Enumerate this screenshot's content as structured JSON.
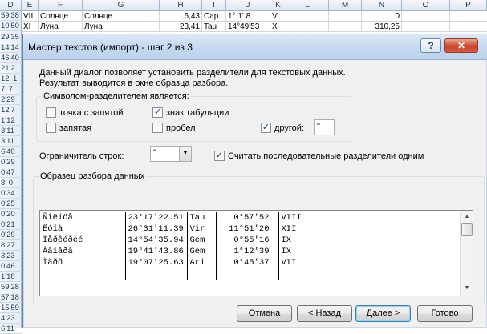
{
  "spreadsheet": {
    "columns": [
      "D",
      "E",
      "F",
      "G",
      "H",
      "I",
      "J",
      "K",
      "L",
      "M",
      "N",
      "O",
      "P"
    ],
    "rows": [
      {
        "num": "59'38",
        "d": "",
        "e": "VII",
        "f": "Солнце",
        "g": "Солнце",
        "h": "6,43",
        "i": "Cap",
        "j": "1° 1' 8",
        "k": "V",
        "n": "0"
      },
      {
        "num": "10'50",
        "d": "",
        "e": "XI",
        "f": "Луна",
        "g": "Луна",
        "h": "23,41",
        "i": "Tau",
        "j": "14°49'53",
        "k": "X",
        "n": "310,25"
      }
    ],
    "row_headers": [
      "29'35",
      "14'14",
      "46'40",
      "21'2",
      "12' 1",
      "7' 7",
      "2'29",
      "12'7",
      "1'12",
      "3'11",
      "3'11",
      "6'40",
      "0'29",
      "0'47",
      "8' 0",
      "0'34",
      "0'25",
      "0'20",
      "0'21",
      "0'29",
      "8'27",
      "3'23",
      "0'46",
      "1'18",
      "59'28",
      "57'18",
      "15'59",
      "4'23",
      "6'11"
    ]
  },
  "dialog": {
    "title": "Мастер текстов (импорт) - шаг 2 из 3",
    "help_button": "?",
    "close_button": "✕",
    "description_line1": "Данный диалог позволяет установить разделители для текстовых данных.",
    "description_line2": "Результат выводится в окне образца разбора.",
    "delimiter_group_label": "Символом-разделителем является:",
    "delimiters": {
      "semicolon": {
        "label": "точка с запятой",
        "checked": false
      },
      "tab": {
        "label": "знак табуляции",
        "checked": true
      },
      "comma": {
        "label": "запятая",
        "checked": false
      },
      "space": {
        "label": "пробел",
        "checked": false
      },
      "other": {
        "label": "другой:",
        "checked": true,
        "value": "\""
      }
    },
    "text_qualifier_label": "Ограничитель строк:",
    "text_qualifier_value": "\"",
    "treat_consecutive_label": "Считать последовательные разделители одним",
    "treat_consecutive_checked": true,
    "preview_label": "Образец разбора данных",
    "preview_rows": [
      [
        "Ñîëíöå",
        "23°17'22.51",
        "Tau",
        "   0°57'52",
        "VIII"
      ],
      [
        "Ëóíà",
        "26°31'11.39",
        "Vir",
        "  11°51'20",
        "XII"
      ],
      [
        "Ìåðêóðèé",
        "14°54'35.94",
        "Gem",
        "   0°55'16",
        "IX"
      ],
      [
        "Âåíåðà",
        "19°41'43.86",
        "Gem",
        "   1°12'39",
        "IX"
      ],
      [
        "Ìàðñ",
        "19°07'25.63",
        "Ari",
        "   0°45'37",
        "VII"
      ]
    ],
    "buttons": {
      "cancel": "Отмена",
      "back": "< Назад",
      "next": "Далее >",
      "finish": "Готово"
    }
  }
}
